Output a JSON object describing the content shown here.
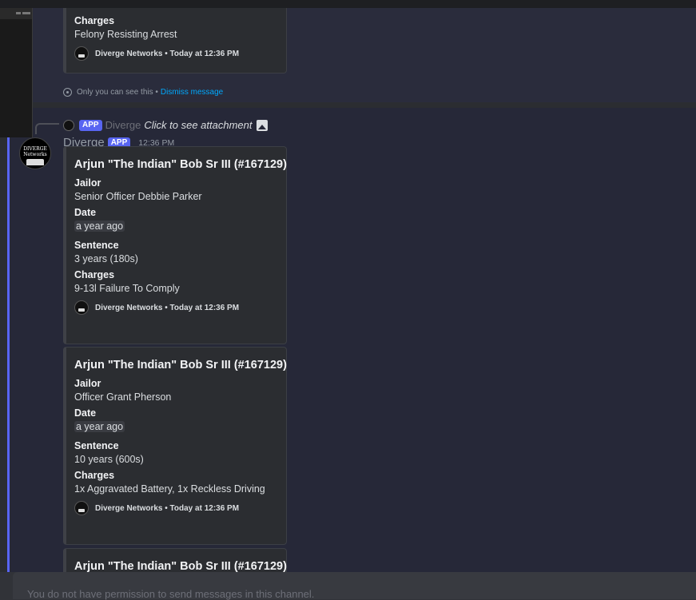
{
  "embed_top": {
    "charges_label": "Charges",
    "charges_value": "Felony Resisting Arrest",
    "footer": "Diverge Networks • Today at 12:36 PM"
  },
  "ephemeral": {
    "text": "Only you can see this •",
    "dismiss": "Dismiss message"
  },
  "reply": {
    "badge": "APP",
    "author": "Diverge",
    "text": "Click to see attachment"
  },
  "message": {
    "author": "Diverge",
    "badge": "APP",
    "time": "12:36 PM",
    "avatar_text": "DIVERGE Networks"
  },
  "embeds": [
    {
      "title": "Arjun \"The Indian\" Bob Sr III (#167129)",
      "jailor_label": "Jailor",
      "jailor": "Senior Officer Debbie Parker",
      "date_label": "Date",
      "date": "a year ago",
      "sentence_label": "Sentence",
      "sentence": "3 years (180s)",
      "charges_label": "Charges",
      "charges": "9-13l Failure To Comply",
      "footer": "Diverge Networks • Today at 12:36 PM"
    },
    {
      "title": "Arjun \"The Indian\" Bob Sr III (#167129)",
      "jailor_label": "Jailor",
      "jailor": "Officer Grant Pherson",
      "date_label": "Date",
      "date": "a year ago",
      "sentence_label": "Sentence",
      "sentence": "10 years (600s)",
      "charges_label": "Charges",
      "charges": "1x Aggravated Battery, 1x Reckless Driving",
      "footer": "Diverge Networks • Today at 12:36 PM"
    },
    {
      "title": "Arjun \"The Indian\" Bob Sr III (#167129)"
    }
  ],
  "chat_input": {
    "text": "You do not have permission to send messages in this channel."
  },
  "colors": {
    "accent": "#5865f2",
    "link": "#00a8fc",
    "background": "#2b2d31"
  }
}
